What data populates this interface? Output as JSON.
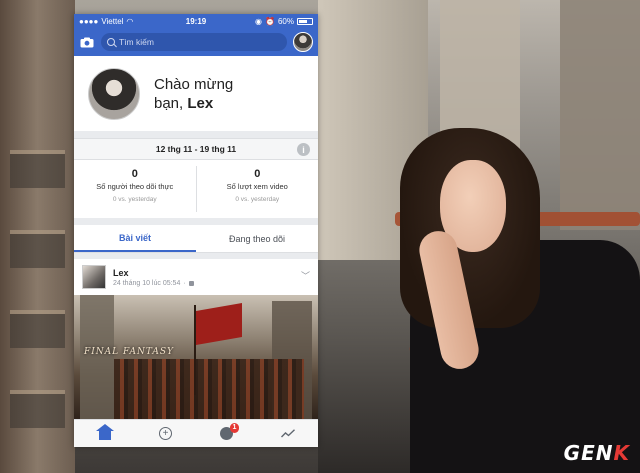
{
  "statusbar": {
    "carrier": "Viettel",
    "time": "19:19",
    "battery": "60%"
  },
  "navbar": {
    "search_placeholder": "Tìm kiếm"
  },
  "welcome": {
    "line1": "Chào mừng",
    "line2_prefix": "bạn, ",
    "name": "Lex"
  },
  "date_range": "12 thg 11 - 19 thg 11",
  "stats": [
    {
      "value": "0",
      "label": "Số người theo dõi thực",
      "comparison": "0 vs. yesterday"
    },
    {
      "value": "0",
      "label": "Số lượt xem video",
      "comparison": "0 vs. yesterday"
    }
  ],
  "tabs": [
    {
      "label": "Bài viết",
      "active": true
    },
    {
      "label": "Đang theo dõi",
      "active": false
    }
  ],
  "post": {
    "author": "Lex",
    "timestamp": "24 tháng 10 lúc 05:54",
    "image_title": "FINAL FANTASY"
  },
  "bottom_nav": {
    "icons": [
      "home-icon",
      "add-icon",
      "globe-icon",
      "trend-icon"
    ],
    "notification_count": "1"
  },
  "brand": {
    "prefix": "GEN",
    "suffix": "K"
  },
  "colors": {
    "facebook_blue": "#3b67c9",
    "badge_red": "#e53935"
  }
}
